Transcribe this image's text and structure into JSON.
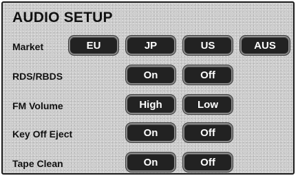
{
  "title": "AUDIO SETUP",
  "rows": [
    {
      "label": "Market",
      "buttons": [
        "EU",
        "JP",
        "US",
        "AUS"
      ]
    },
    {
      "label": "RDS/RBDS",
      "buttons": [
        "On",
        "Off"
      ]
    },
    {
      "label": "FM Volume",
      "buttons": [
        "High",
        "Low"
      ]
    },
    {
      "label": "Key Off Eject",
      "buttons": [
        "On",
        "Off"
      ]
    },
    {
      "label": "Tape Clean",
      "buttons": [
        "On",
        "Off"
      ]
    }
  ]
}
